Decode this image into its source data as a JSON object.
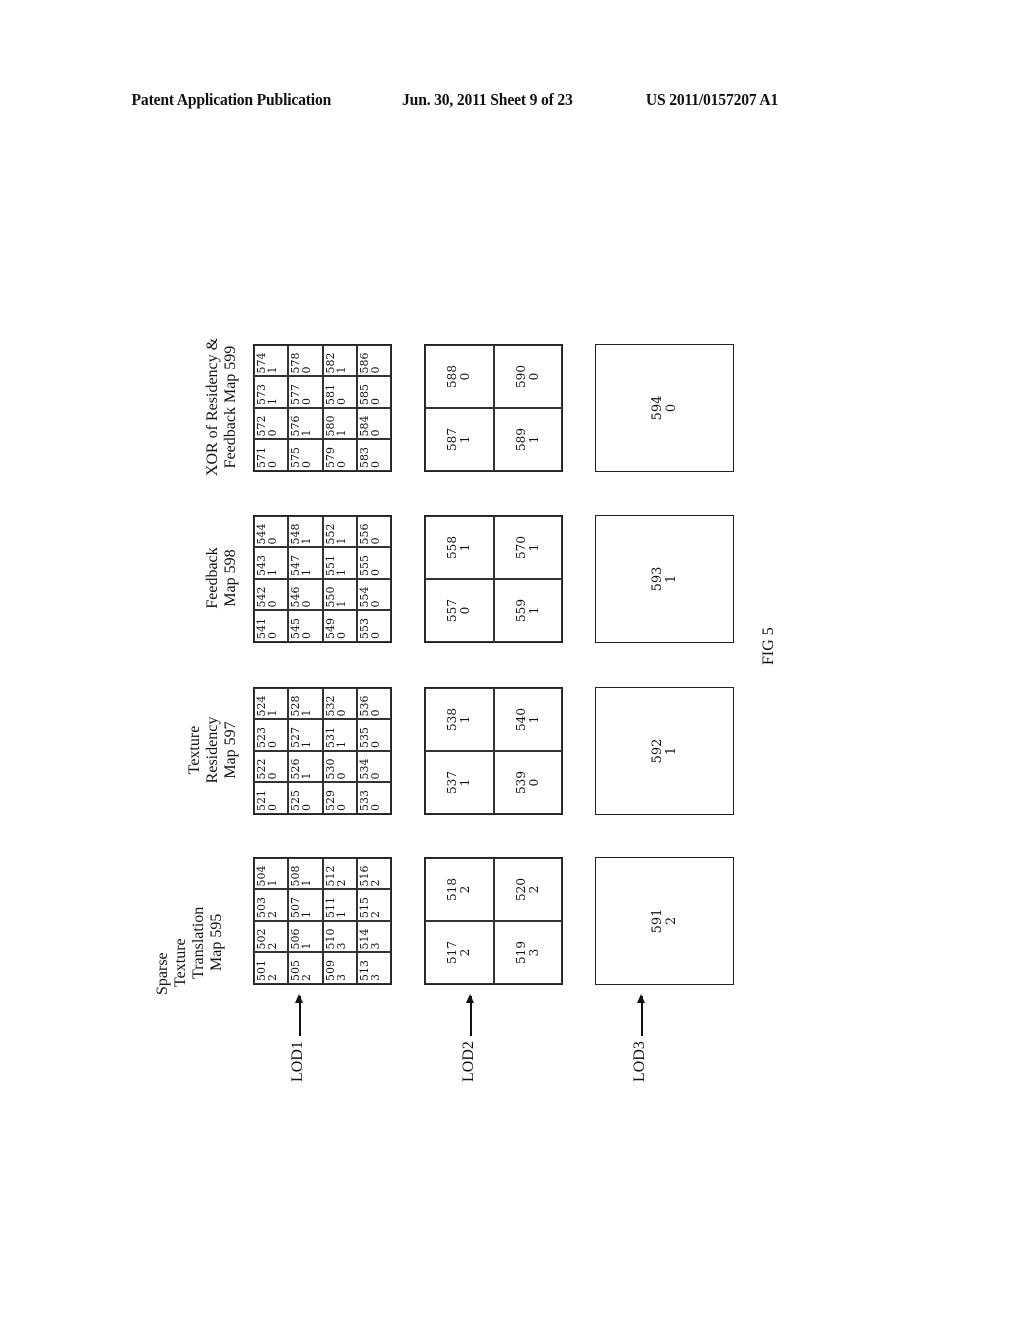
{
  "header": {
    "publication": "Patent Application Publication",
    "date_sheet": "Jun. 30, 2011   Sheet 9 of 23",
    "patent_number": "US 2011/0157207 A1"
  },
  "figure_label": "FIG 5",
  "lod_labels": [
    "LOD1",
    "LOD2",
    "LOD3"
  ],
  "maps": [
    {
      "title_lines": [
        "Sparse",
        "Texture",
        "Translation",
        "Map 595"
      ],
      "lod1": [
        {
          "id": "501",
          "v": "2"
        },
        {
          "id": "502",
          "v": "2"
        },
        {
          "id": "503",
          "v": "2"
        },
        {
          "id": "504",
          "v": "1"
        },
        {
          "id": "505",
          "v": "2"
        },
        {
          "id": "506",
          "v": "1"
        },
        {
          "id": "507",
          "v": "1"
        },
        {
          "id": "508",
          "v": "1"
        },
        {
          "id": "509",
          "v": "3"
        },
        {
          "id": "510",
          "v": "3"
        },
        {
          "id": "511",
          "v": "1"
        },
        {
          "id": "512",
          "v": "2"
        },
        {
          "id": "513",
          "v": "3"
        },
        {
          "id": "514",
          "v": "3"
        },
        {
          "id": "515",
          "v": "2"
        },
        {
          "id": "516",
          "v": "2"
        }
      ],
      "lod2": [
        {
          "id": "517",
          "v": "2"
        },
        {
          "id": "518",
          "v": "2"
        },
        {
          "id": "519",
          "v": "3"
        },
        {
          "id": "520",
          "v": "2"
        }
      ],
      "lod3": {
        "id": "591",
        "v": "2"
      }
    },
    {
      "title_lines": [
        "Texture",
        "Residency",
        "Map 597"
      ],
      "lod1": [
        {
          "id": "521",
          "v": "0"
        },
        {
          "id": "522",
          "v": "0"
        },
        {
          "id": "523",
          "v": "0"
        },
        {
          "id": "524",
          "v": "1"
        },
        {
          "id": "525",
          "v": "0"
        },
        {
          "id": "526",
          "v": "1"
        },
        {
          "id": "527",
          "v": "1"
        },
        {
          "id": "528",
          "v": "1"
        },
        {
          "id": "529",
          "v": "0"
        },
        {
          "id": "530",
          "v": "0"
        },
        {
          "id": "531",
          "v": "1"
        },
        {
          "id": "532",
          "v": "0"
        },
        {
          "id": "533",
          "v": "0"
        },
        {
          "id": "534",
          "v": "0"
        },
        {
          "id": "535",
          "v": "0"
        },
        {
          "id": "536",
          "v": "0"
        }
      ],
      "lod2": [
        {
          "id": "537",
          "v": "1"
        },
        {
          "id": "538",
          "v": "1"
        },
        {
          "id": "539",
          "v": "0"
        },
        {
          "id": "540",
          "v": "1"
        }
      ],
      "lod3": {
        "id": "592",
        "v": "1"
      }
    },
    {
      "title_lines": [
        "Feedback",
        "Map 598"
      ],
      "lod1": [
        {
          "id": "541",
          "v": "0"
        },
        {
          "id": "542",
          "v": "0"
        },
        {
          "id": "543",
          "v": "1"
        },
        {
          "id": "544",
          "v": "0"
        },
        {
          "id": "545",
          "v": "0"
        },
        {
          "id": "546",
          "v": "0"
        },
        {
          "id": "547",
          "v": "1"
        },
        {
          "id": "548",
          "v": "1"
        },
        {
          "id": "549",
          "v": "0"
        },
        {
          "id": "550",
          "v": "1"
        },
        {
          "id": "551",
          "v": "1"
        },
        {
          "id": "552",
          "v": "1"
        },
        {
          "id": "553",
          "v": "0"
        },
        {
          "id": "554",
          "v": "0"
        },
        {
          "id": "555",
          "v": "0"
        },
        {
          "id": "556",
          "v": "0"
        }
      ],
      "lod2": [
        {
          "id": "557",
          "v": "0"
        },
        {
          "id": "558",
          "v": "1"
        },
        {
          "id": "559",
          "v": "1"
        },
        {
          "id": "570",
          "v": "1"
        }
      ],
      "lod3": {
        "id": "593",
        "v": "1"
      }
    },
    {
      "title_lines": [
        "XOR of Residency &",
        "Feedback Map 599"
      ],
      "lod1": [
        {
          "id": "571",
          "v": "0"
        },
        {
          "id": "572",
          "v": "0"
        },
        {
          "id": "573",
          "v": "1"
        },
        {
          "id": "574",
          "v": "1"
        },
        {
          "id": "575",
          "v": "0"
        },
        {
          "id": "576",
          "v": "1"
        },
        {
          "id": "577",
          "v": "0"
        },
        {
          "id": "578",
          "v": "0"
        },
        {
          "id": "579",
          "v": "0"
        },
        {
          "id": "580",
          "v": "1"
        },
        {
          "id": "581",
          "v": "0"
        },
        {
          "id": "582",
          "v": "1"
        },
        {
          "id": "583",
          "v": "0"
        },
        {
          "id": "584",
          "v": "0"
        },
        {
          "id": "585",
          "v": "0"
        },
        {
          "id": "586",
          "v": "0"
        }
      ],
      "lod2": [
        {
          "id": "587",
          "v": "1"
        },
        {
          "id": "588",
          "v": "0"
        },
        {
          "id": "589",
          "v": "1"
        },
        {
          "id": "590",
          "v": "0"
        }
      ],
      "lod3": {
        "id": "594",
        "v": "0"
      }
    }
  ]
}
